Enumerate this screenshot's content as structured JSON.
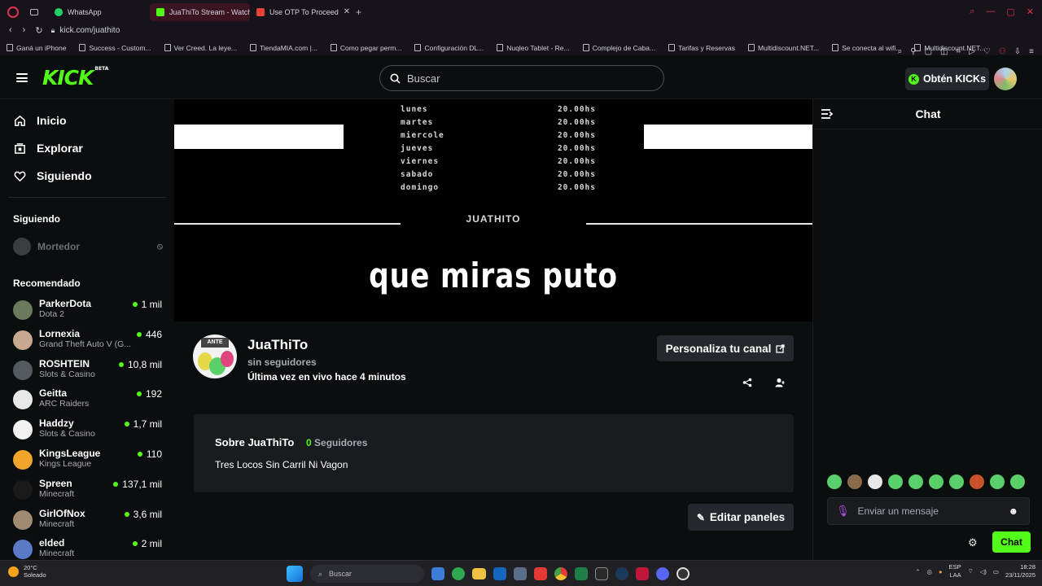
{
  "browser": {
    "tabs": [
      {
        "label": "WhatsApp",
        "active": false,
        "color": "#25d366"
      },
      {
        "label": "JuaThiTo Stream - Watch",
        "active": true,
        "color": "#53fc18"
      },
      {
        "label": "Use OTP To Proceed",
        "active": false,
        "color": "#ea4335"
      }
    ],
    "new_tab": "+",
    "url": "kick.com/juathito",
    "bookmarks": [
      "Ganá un iPhone",
      "Success - Custom...",
      "Ver Creed. La leye...",
      "TiendaMIA.com |...",
      "Como pegar perm...",
      "Configuración DL...",
      "Nuqleo Tablet - Re...",
      "Complejo de Caba...",
      "Tarifas y Reservas",
      "Multidiscount.NET...",
      "Se conecta al wifi...",
      "Multidiscount.NET..."
    ]
  },
  "header": {
    "logo": "KICK",
    "logo_badge": "BETA",
    "search_placeholder": "Buscar",
    "kicks_button": "Obtén KICKs",
    "kicks_coin": "K"
  },
  "sidebar": {
    "nav": [
      {
        "label": "Inicio",
        "icon": "home-icon"
      },
      {
        "label": "Explorar",
        "icon": "browse-icon"
      },
      {
        "label": "Siguiendo",
        "icon": "heart-icon"
      }
    ],
    "following_title": "Siguiendo",
    "following": [
      {
        "name": "Mortedor"
      }
    ],
    "recommended_title": "Recomendado",
    "recommended": [
      {
        "name": "ParkerDota",
        "category": "Dota 2",
        "viewers": "1 mil",
        "color": "#6a7a5a"
      },
      {
        "name": "Lornexia",
        "category": "Grand Theft Auto V (G...",
        "viewers": "446",
        "color": "#c8a890"
      },
      {
        "name": "ROSHTEIN",
        "category": "Slots & Casino",
        "viewers": "10,8 mil",
        "color": "#555a60"
      },
      {
        "name": "Geitta",
        "category": "ARC Raiders",
        "viewers": "192",
        "color": "#e8e8e8"
      },
      {
        "name": "Haddzy",
        "category": "Slots & Casino",
        "viewers": "1,7 mil",
        "color": "#f2f2f2"
      },
      {
        "name": "KingsLeague",
        "category": "Kings League",
        "viewers": "110",
        "color": "#f2a52b"
      },
      {
        "name": "Spreen",
        "category": "Minecraft",
        "viewers": "137,1 mil",
        "color": "#1a1a1a"
      },
      {
        "name": "GirlOfNox",
        "category": "Minecraft",
        "viewers": "3,6 mil",
        "color": "#a08a70"
      },
      {
        "name": "elded",
        "category": "Minecraft",
        "viewers": "2 mil",
        "color": "#5a7ac8"
      }
    ]
  },
  "player": {
    "schedule": [
      {
        "day": "lunes",
        "time": "20.00hs"
      },
      {
        "day": "martes",
        "time": "20.00hs"
      },
      {
        "day": "miercole",
        "time": "20.00hs"
      },
      {
        "day": "jueves",
        "time": "20.00hs"
      },
      {
        "day": "viernes",
        "time": "20.00hs"
      },
      {
        "day": "sabado",
        "time": "20.00hs"
      },
      {
        "day": "domingo",
        "time": "20.00hs"
      }
    ],
    "brand": "JUATHITO",
    "caption": "que miras puto"
  },
  "channel": {
    "name": "JuaThiTo",
    "followers": "sin seguidores",
    "last_live": "Última vez en vivo hace 4 minutos",
    "customize_button": "Personaliza tu canal",
    "avatar_label": "ANTE",
    "about_title": "Sobre JuaThiTo",
    "about_count": "0",
    "about_count_label": "Seguidores",
    "about_desc": "Tres Locos Sin Carril Ni Vagon",
    "edit_panels_button": "Editar paneles"
  },
  "chat": {
    "title": "Chat",
    "input_placeholder": "Enviar un mensaje",
    "send_button": "Chat",
    "emotes": [
      "#5ad06a",
      "#8a6a4a",
      "#e8e8e8",
      "#5ad06a",
      "#5ad06a",
      "#5ad06a",
      "#5ad06a",
      "#c8502a",
      "#5ad06a",
      "#5ad06a"
    ]
  },
  "taskbar": {
    "weather_temp": "20°C",
    "weather_desc": "Soleado",
    "search": "Buscar",
    "lang": "ESP",
    "lang_sub": "LAA",
    "time": "18:28",
    "date": "23/11/2025"
  }
}
